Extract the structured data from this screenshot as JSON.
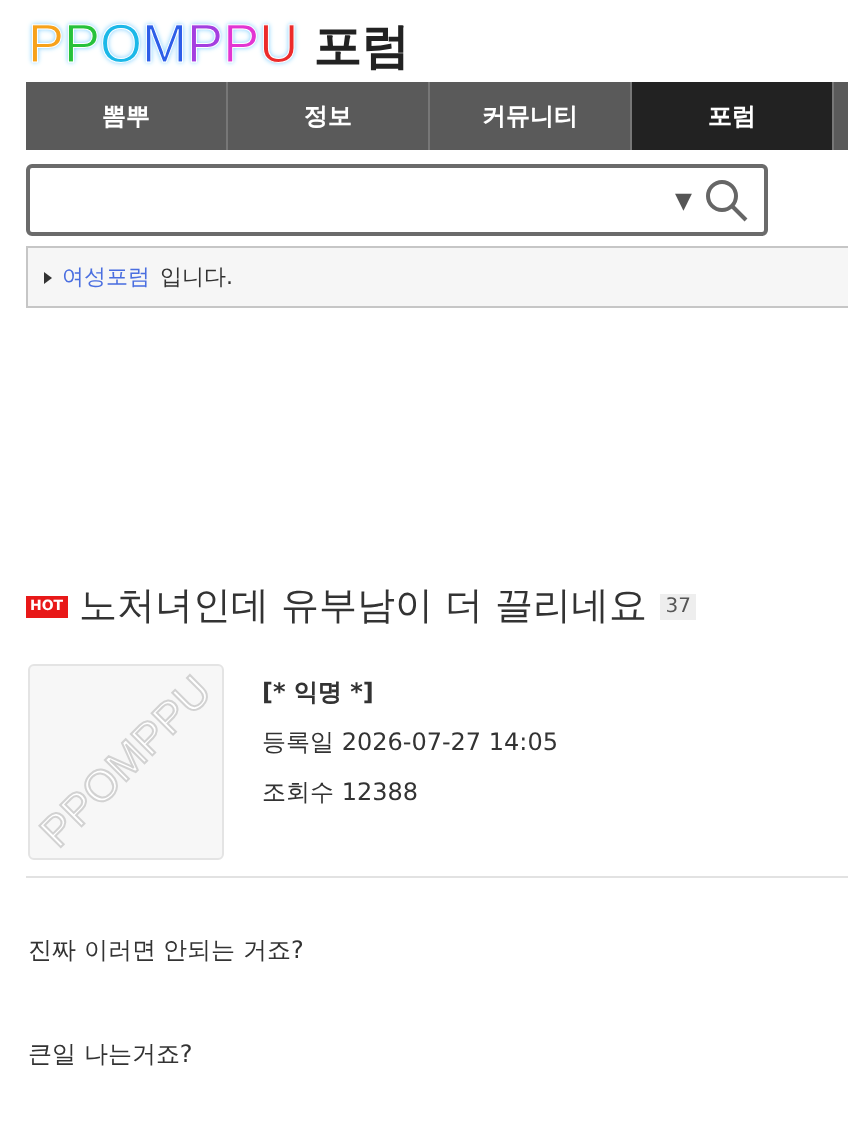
{
  "logo": {
    "brand": "PPOMPPU",
    "section": "포럼"
  },
  "nav": [
    {
      "label": "뽐뿌",
      "selected": false
    },
    {
      "label": "정보",
      "selected": false
    },
    {
      "label": "커뮤니티",
      "selected": false
    },
    {
      "label": "포럼",
      "selected": true
    }
  ],
  "search": {
    "dropdown": "▼"
  },
  "breadcrumb": {
    "link": "여성포럼",
    "suffix": "입니다."
  },
  "post": {
    "badge": "HOT",
    "title": "노처녀인데 유부남이 더 끌리네요",
    "comment_count": "37",
    "avatar_text": "PPOMPPU",
    "author": "[* 익명 *]",
    "date_label": "등록일",
    "date": "2026-07-27 14:05",
    "views_label": "조회수",
    "views": "12388",
    "body": [
      "진짜 이러면 안되는 거죠?",
      "큰일 나는거죠?"
    ]
  }
}
